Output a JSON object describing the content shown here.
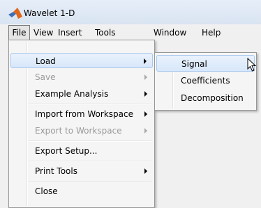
{
  "window": {
    "title": "Wavelet 1-D"
  },
  "menubar": {
    "items": [
      "File",
      "View",
      "Insert",
      "Tools",
      "Window",
      "Help"
    ]
  },
  "file_menu": {
    "items": [
      {
        "label": "Load",
        "submenu": true,
        "enabled": true,
        "highlighted": true
      },
      {
        "label": "Save",
        "submenu": true,
        "enabled": false
      },
      {
        "label": "Example Analysis",
        "submenu": true,
        "enabled": true
      },
      {
        "label": "Import from Workspace",
        "submenu": true,
        "enabled": true
      },
      {
        "label": "Export to Workspace",
        "submenu": true,
        "enabled": false
      },
      {
        "label": "Export Setup...",
        "submenu": false,
        "enabled": true
      },
      {
        "label": "Print Tools",
        "submenu": true,
        "enabled": true
      },
      {
        "label": "Close",
        "submenu": false,
        "enabled": true
      }
    ]
  },
  "load_submenu": {
    "items": [
      {
        "label": "Signal",
        "highlighted": true
      },
      {
        "label": "Coefficients"
      },
      {
        "label": "Decomposition"
      }
    ]
  },
  "icons": {
    "app": "matlab-logo-icon",
    "cursor": "mouse-pointer-icon"
  }
}
